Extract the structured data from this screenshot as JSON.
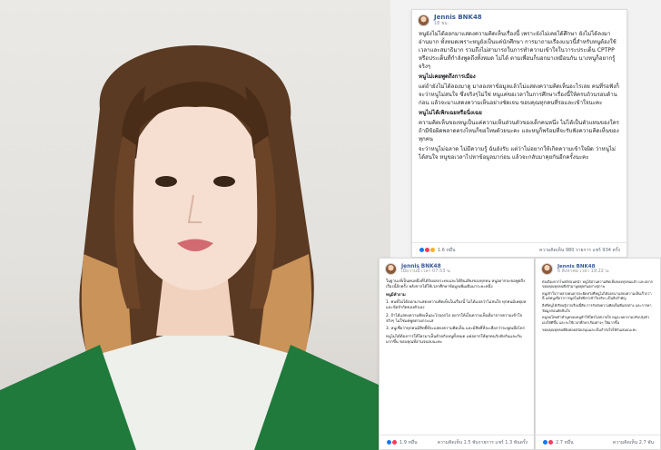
{
  "photo": {
    "subject": "portrait-photo"
  },
  "posts": [
    {
      "author": "Jennis BNK48",
      "time": "18 ชม.",
      "paragraphs": [
        {
          "text": "หนูยังไม่ได้ออกมาแสดงความคิดเห็นเรื่องนี้ เพราะยังไม่เคยได้ศึกษา ยังไม่ได้ลงมาอ่านมาก ทั้งหมดเพราะหนูยังเป็นแค่นักศึกษา การมาถามเรื่องแนวนี้สำหรับหนูต้องใช้เวลาและสมาธิมาก รวมถึงไม่สามารถในการทำความเข้าใจในวาระประเด็น CPTPP หรือประเด็นที่กำลังพูดถึงทั้งหมด ไม่ได้ ตามเพื่อนก็บอกมาเหมือนกัน นางหนูก็อยากรู้จริงๆ",
          "bold": false
        },
        {
          "text": "หนูไม่เคยพูดถึงการเมือง",
          "bold": true
        },
        {
          "text": "แต่ถ้ายังไม่ได้ลองมาดู มาลองหาข้อมูลแล้วไม่แสดงความคิดเห็นอะไรเลย คนที่รอฟังก็จะว่าหนูไม่สนใจ ซึ่งจริงๆไม่ใช่ หนูแค่ขอเวลาในการศึกษาเรื่องนี้ให้ครบถ้วนรอบด้านก่อน แล้วจะมาแสดงความเห็นอย่างชัดเจน ขอบคุณทุกคนที่รอและเข้าใจนะคะ",
          "bold": false
        },
        {
          "text": "หนูไม่ได้เพิกเฉยหรือนิ่งเฉย",
          "bold": true
        },
        {
          "text": "ความคิดเห็นของหนูเป็นแค่ความเห็นส่วนตัวของเด็กคนหนึ่ง ไม่ได้เป็นตัวแทนของใคร ถ้ามีข้อผิดพลาดตรงไหนก็ขอโทษด้วยนะคะ และหนูก็พร้อมที่จะรับฟังความคิดเห็นของทุกคน",
          "bold": false
        },
        {
          "text": "จะว่าหนูไม่ฉลาด ไม่มีความรู้ ฉันยังรับ แต่ว่าไม่อยากให้เกิดความเข้าใจผิด ว่าหนูไม่ได้สนใจ หนูขอเวลาไปหาข้อมูลมาก่อน แล้วจะกลับมาคุยกันอีกครั้งนะคะ",
          "bold": false
        }
      ],
      "reactions": "1.6 หมื่น",
      "stats": "ความคิดเห็น 980 รายการ แชร์ 934 ครั้ง"
    },
    {
      "author": "Jennis BNK48",
      "time": "เมื่อวานนี้ เวลา 07:53 น.",
      "paragraphs": [
        {
          "text": "ในฐานะที่เป็นคนหนึ่งที่ได้รับผลกระทบและได้ยินเสียงของทุกคน หนูอยากจะขอพูดถึงเรื่องนี้อีกครั้ง หลังจากได้ใช้เวลาศึกษาข้อมูลเพิ่มเติมมาระยะหนึ่ง",
          "bold": false
        },
        {
          "text": "หนูมีคำถาม",
          "bold": true
        },
        {
          "text": "1. คนที่ไม่ได้ออกมาแสดงความคิดเห็นในเรื่องนี้ ไม่ได้แปลว่าไม่สนใจ ทุกคนมีเหตุผลและข้อจำกัดของตัวเอง",
          "bold": false
        },
        {
          "text": "2. ถ้าได้แสดงความคิดเห็นอะไรออกไป อยากให้เป็นความเห็นที่มาจากความเข้าใจจริงๆ ไม่ใช่แค่พูดตามกระแส",
          "bold": false
        },
        {
          "text": "3. หนูเชื่อว่าทุกคนมีสิทธิ์ที่จะแสดงความคิดเห็น และมีสิทธิ์ที่จะเลือกว่าจะพูดเมื่อไหร่",
          "bold": false
        },
        {
          "text": "หนูไม่ได้ต้องการให้ใครมาเห็นด้วยกับหนูทั้งหมด แค่อยากให้ทุกคนรับฟังกันและกันมากขึ้น ขอบคุณที่อ่านจนจบนะคะ",
          "bold": false
        }
      ],
      "reactions": "1.9 หมื่น",
      "stats": "ความคิดเห็น 1.5 พันรายการ แชร์ 1.3 พันครั้ง"
    },
    {
      "author": "Jennis BNK48",
      "time": "6 สิงหาคม เวลา 19:22 น.",
      "paragraphs": [
        {
          "text": "ต่อเนื่องจากโพสต์ก่อนหน้า หนูได้อ่านความคิดเห็นของทุกคนแล้ว และอยากขอบคุณทุกคนที่เข้ามาพูดคุยกันอย่างสุภาพ",
          "bold": false
        },
        {
          "text": "หนูเข้าใจว่าหลายคนอาจจะผิดหวังที่หนูไม่ได้ออกมาแสดงความเห็นเร็วกว่านี้ แต่หนูเชื่อว่าการพูดในสิ่งที่เราเข้าใจจริงๆ เป็นสิ่งสำคัญ",
          "bold": false
        },
        {
          "text": "สิ่งที่หนูได้เรียนรู้จากเรื่องนี้คือ การรับฟังความคิดเห็นที่แตกต่าง และการหาข้อมูลก่อนตัดสินใจ",
          "bold": false
        },
        {
          "text": "หนูขอโทษถ้าคำพูดของหนูทำให้ใครไม่สบายใจ หนูจะพยายามปรับปรุงตัวเองให้ดีขึ้น และจะใช้เวลาศึกษาเรื่องต่างๆ ให้มากขึ้น",
          "bold": false
        },
        {
          "text": "ขอบคุณทุกคนที่ยังคอยสนับสนุนและเป็นกำลังใจให้กันเสมอนะคะ",
          "bold": false
        }
      ],
      "reactions": "2.7 หมื่น",
      "stats": "ความคิดเห็น 2.7 พัน"
    }
  ]
}
